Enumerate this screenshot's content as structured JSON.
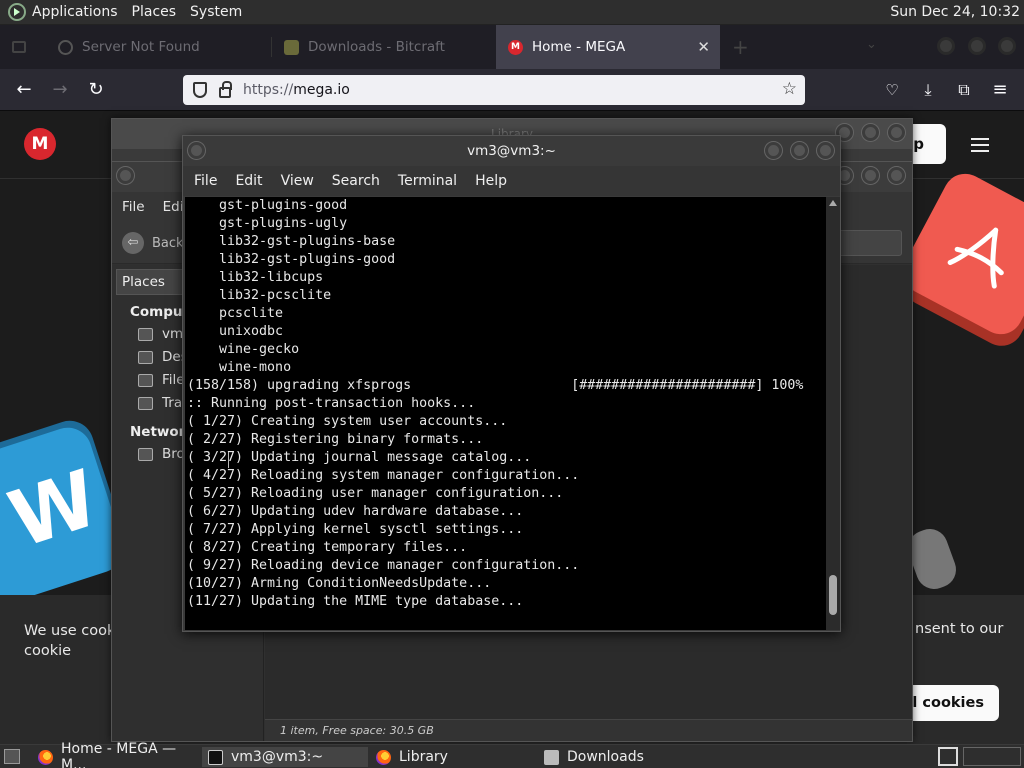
{
  "top_panel": {
    "menus": [
      "Applications",
      "Places",
      "System"
    ],
    "clock": "Sun Dec 24, 10:32"
  },
  "browser": {
    "tabs": [
      {
        "label": "Server Not Found",
        "active": false
      },
      {
        "label": "Downloads - Bitcraft",
        "active": false
      },
      {
        "label": "Home - MEGA",
        "active": true
      }
    ],
    "url_scheme": "https://",
    "url_host": "mega.io"
  },
  "mega": {
    "logo": "M",
    "header_button": "p",
    "cookie_text_left": "We use cookie use of cookie",
    "cookie_text_right": "nsent to our",
    "cookie_button": "all cookies"
  },
  "file_manager": {
    "title": "Library",
    "menu": [
      "File",
      "Edi"
    ],
    "back_label": "Back",
    "places_header": "Places",
    "computer_section": "Comput",
    "items": [
      "vm",
      "Des",
      "File",
      "Tra"
    ],
    "network_section": "Network",
    "network_items": [
      "Bro"
    ],
    "status": "1 item, Free space: 30.5 GB"
  },
  "terminal": {
    "title": "vm3@vm3:~",
    "menu": [
      "File",
      "Edit",
      "View",
      "Search",
      "Terminal",
      "Help"
    ],
    "lines": [
      "    gst-plugins-good",
      "    gst-plugins-ugly",
      "    lib32-gst-plugins-base",
      "    lib32-gst-plugins-good",
      "    lib32-libcups",
      "    lib32-pcsclite",
      "    pcsclite",
      "    unixodbc",
      "    wine-gecko",
      "    wine-mono",
      "(158/158) upgrading xfsprogs                    [######################] 100%",
      ":: Running post-transaction hooks...",
      "( 1/27) Creating system user accounts...",
      "( 2/27) Registering binary formats...",
      "( 3/27) Updating journal message catalog...",
      "( 4/27) Reloading system manager configuration...",
      "( 5/27) Reloading user manager configuration...",
      "( 6/27) Updating udev hardware database...",
      "( 7/27) Applying kernel sysctl settings...",
      "( 8/27) Creating temporary files...",
      "( 9/27) Reloading device manager configuration...",
      "(10/27) Arming ConditionNeedsUpdate...",
      "(11/27) Updating the MIME type database..."
    ]
  },
  "taskbar": {
    "items": [
      {
        "label": "Home - MEGA — M...",
        "icon": "firefox-icon"
      },
      {
        "label": "vm3@vm3:~",
        "icon": "terminal-icon"
      },
      {
        "label": "Library",
        "icon": "firefox-icon"
      },
      {
        "label": "Downloads",
        "icon": "folder-icon"
      }
    ]
  },
  "colors": {
    "mega_red": "#d9272e",
    "firefox_active_tab": "#42414d",
    "terminal_bg": "#000000"
  }
}
